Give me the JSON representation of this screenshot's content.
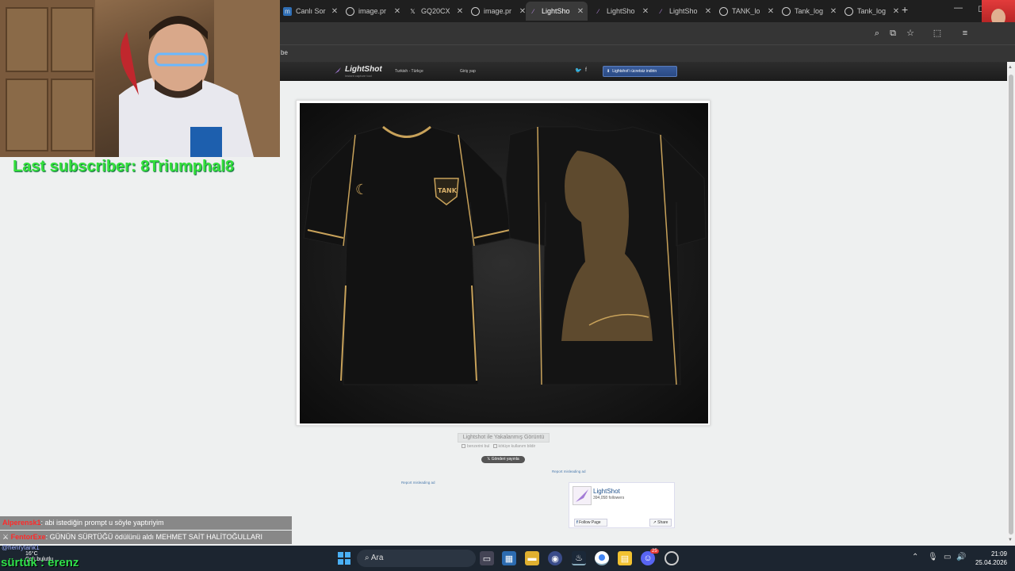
{
  "browser": {
    "tabs": [
      {
        "label": "Canlı Sor",
        "icon": "app-icon",
        "active": false
      },
      {
        "label": "image.pr",
        "icon": "globe-icon",
        "active": false
      },
      {
        "label": "GQ20CX",
        "icon": "x-icon",
        "active": false
      },
      {
        "label": "image.pr",
        "icon": "globe-icon",
        "active": false
      },
      {
        "label": "LightSho",
        "icon": "feather-icon",
        "active": true
      },
      {
        "label": "LightSho",
        "icon": "feather-icon",
        "active": false
      },
      {
        "label": "LightSho",
        "icon": "feather-icon",
        "active": false
      },
      {
        "label": "TANK_lo",
        "icon": "globe-icon",
        "active": false
      },
      {
        "label": "Tank_log",
        "icon": "globe-icon",
        "active": false
      },
      {
        "label": "Tank_log",
        "icon": "globe-icon",
        "active": false
      }
    ],
    "new_tab": "+",
    "bookmark_fragment": "be"
  },
  "lightshot": {
    "logo": "LightShot",
    "logo_sub": "instant capture tool",
    "language": "Turkish - Türkçe",
    "login": "Giriş yap",
    "download": "Lightshot'ı ücretsiz indirin",
    "caption": "Lightshot ile Yakalanmış Görüntü",
    "opt1": "benzerini bul",
    "opt2": "kötüye kullanım bildir",
    "tweet": "Gönderi yayınla",
    "report_left": "Report misleading ad",
    "report_right": "Report misleading ad",
    "fb": {
      "name": "LightShot",
      "followers": "394,058 followers",
      "follow": "Follow Page",
      "share": "Share"
    }
  },
  "stream": {
    "last_subscriber": "Last subscriber: 8Triumphal8",
    "chat": [
      {
        "user": "Alperensk1",
        "message": ": abi istediğin prompt u söyle yaptıriyim"
      },
      {
        "user": "FentorExe",
        "message": ": GÜNÜN SÜRTÜĞÜ ödülünü aldı MEHMET SAİT HALİTOĞULLARI"
      }
    ],
    "handle": "@henrytank1",
    "bottom_text": "sürtük : erenz",
    "weather_temp": "16°C",
    "weather_desc": "Çok bulutlu"
  },
  "taskbar": {
    "search": "Ara",
    "time": "21:09",
    "date": "25.04.2026",
    "discord_badge": "25"
  },
  "colors": {
    "accent_green": "#35e03c",
    "chat_user": "#ff2a2a",
    "download_blue": "#2a4a84"
  }
}
